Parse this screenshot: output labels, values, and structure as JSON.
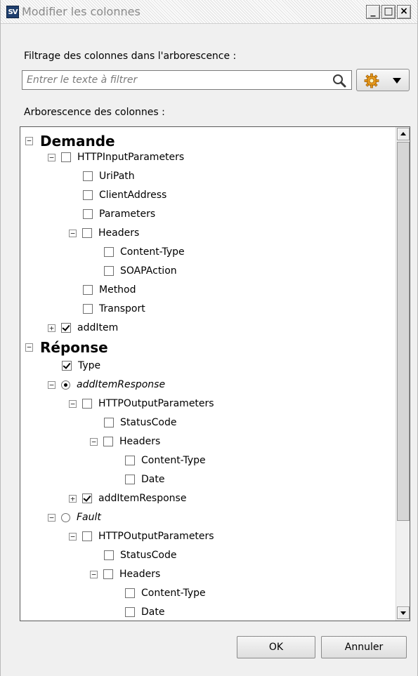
{
  "window": {
    "title": "Modifier les colonnes",
    "app_icon_text": "SV",
    "controls": {
      "minimize": "_",
      "maximize": "□",
      "close": "×"
    }
  },
  "filter": {
    "label": "Filtrage des colonnes dans l'arborescence :",
    "placeholder": "Entrer le texte à filtrer",
    "value": ""
  },
  "tree": {
    "label": "Arborescence des colonnes :",
    "sections": {
      "request": "Demande",
      "response": "Réponse"
    },
    "nodes": {
      "http_input_params": "HTTPInputParameters",
      "uri_path": "UriPath",
      "client_address": "ClientAddress",
      "parameters": "Parameters",
      "headers": "Headers",
      "content_type": "Content-Type",
      "soap_action": "SOAPAction",
      "method": "Method",
      "transport": "Transport",
      "add_item": "addItem",
      "type": "Type",
      "add_item_response_choice": "addItemResponse",
      "http_output_params": "HTTPOutputParameters",
      "status_code": "StatusCode",
      "headers_out": "Headers",
      "content_type_out": "Content-Type",
      "date": "Date",
      "add_item_response": "addItemResponse",
      "fault": "Fault",
      "http_output_params_fault": "HTTPOutputParameters",
      "status_code_fault": "StatusCode",
      "headers_fault": "Headers",
      "content_type_fault": "Content-Type",
      "date_fault": "Date"
    },
    "expander_symbols": {
      "collapse": "−",
      "expand": "+"
    }
  },
  "buttons": {
    "ok": "OK",
    "cancel": "Annuler"
  },
  "colors": {
    "title_text": "#8a8a8a",
    "window_bg": "#f0f0f0",
    "panel_border": "#5a5a5a"
  }
}
